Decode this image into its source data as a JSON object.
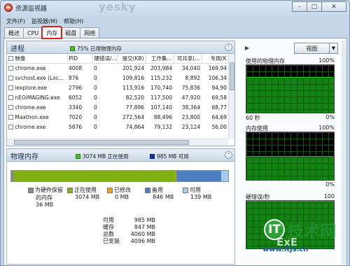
{
  "window": {
    "title": "资源监视器",
    "watermark_top": "yesky"
  },
  "menubar": {
    "items": [
      "文件(F)",
      "监视器(M)",
      "帮助(H)"
    ]
  },
  "tabs": [
    "概述",
    "CPU",
    "内存",
    "磁盘",
    "网络"
  ],
  "active_tab": "内存",
  "process": {
    "title": "进程",
    "status": "75% 已用物理内存",
    "columns": [
      "映像",
      "PID",
      "硬错误/...",
      "提交(KB)",
      "工作集...",
      "可共享(...",
      "专用(K"
    ],
    "rows": [
      [
        "chrome.exe",
        "4008",
        "0",
        "201,924",
        "203,984",
        "34,040",
        "169,94"
      ],
      [
        "svchost.exe (Loc...",
        "876",
        "0",
        "109,816",
        "115,232",
        "8,892",
        "106,34"
      ],
      [
        "iexplore.exe",
        "2796",
        "0",
        "113,916",
        "170,740",
        "75,836",
        "94,90"
      ],
      [
        "nEOiMAGING.exe",
        "6052",
        "0",
        "82,520",
        "117,500",
        "47,920",
        "69,58"
      ],
      [
        "chrome.exe",
        "3340",
        "0",
        "77,896",
        "107,140",
        "38,364",
        "68,77"
      ],
      [
        "Maxthon.exe",
        "7020",
        "0",
        "272,564",
        "88,496",
        "23,800",
        "64,69"
      ],
      [
        "chrome.exe",
        "5876",
        "0",
        "74,864",
        "79,132",
        "23,124",
        "56,00"
      ]
    ]
  },
  "memory": {
    "title": "物理内存",
    "in_use_label": "3074 MB 正在使用",
    "available_label": "985 MB 可用",
    "bar_fractions": {
      "reserved": 0.009,
      "in_use": 0.75,
      "modified": 0.002,
      "standby": 0.206,
      "free": 0.033
    },
    "legend": [
      {
        "name": "为硬件保留的内存",
        "line1": "为硬件保留",
        "line2": "的内存",
        "value": "36 MB",
        "color": "#8a8a8a"
      },
      {
        "name": "正在使用",
        "value": "3074 MB",
        "color": "#80b010"
      },
      {
        "name": "已修改",
        "value": "0 MB",
        "color": "#f0a020"
      },
      {
        "name": "备用",
        "value": "846 MB",
        "color": "#4f7fc3"
      },
      {
        "name": "可用",
        "value": "139 MB",
        "color": "#a9c9ec"
      }
    ],
    "stats": [
      {
        "k": "可用",
        "v": "985 MB"
      },
      {
        "k": "缓存",
        "v": "847 MB"
      },
      {
        "k": "总数",
        "v": "4060 MB"
      },
      {
        "k": "已安装",
        "v": "4096 MB"
      }
    ]
  },
  "right": {
    "view_label": "视图",
    "graphs": [
      {
        "title": "使用的物理内存",
        "top_pct": "100%",
        "foot_left": "60 秒",
        "foot_right": "0%",
        "fill": 0.75
      },
      {
        "title": "内存使用",
        "top_pct": "100%",
        "foot_left": "",
        "foot_right": "0%",
        "fill": 0.5
      },
      {
        "title": "硬错误/秒",
        "top_pct": "100",
        "foot_left": "",
        "foot_right": "",
        "fill": 1.0
      }
    ]
  },
  "watermark": {
    "text": "技术网",
    "sub": "www.itjs.cn",
    "ghost": "ExE"
  },
  "colors": {
    "in_use": "#80b010",
    "standby": "#4f7fc3",
    "graph_green": "#118411",
    "tab_highlight": "#e21b1b"
  }
}
